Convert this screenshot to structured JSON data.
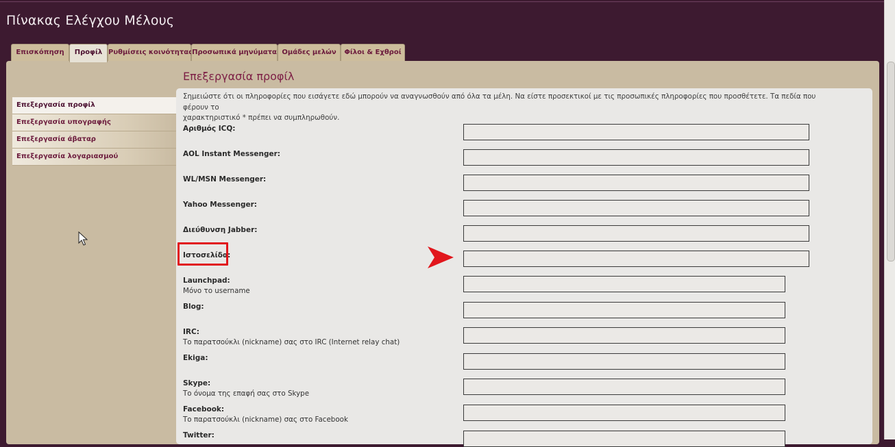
{
  "header": {
    "title": "Πίνακας Ελέγχου Μέλους"
  },
  "tabs": [
    {
      "label": "Επισκόπηση"
    },
    {
      "label": "Προφίλ"
    },
    {
      "label": "Ρυθμίσεις κοινότητας"
    },
    {
      "label": "Προσωπικά μηνύματα"
    },
    {
      "label": "Ομάδες μελών"
    },
    {
      "label": "Φίλοι & Εχθροί"
    }
  ],
  "sidebar": {
    "items": [
      {
        "label": "Επεξεργασία προφίλ"
      },
      {
        "label": "Επεξεργασία υπογραφής"
      },
      {
        "label": "Επεξεργασία άβαταρ"
      },
      {
        "label": "Επεξεργασία λογαριασμού"
      }
    ]
  },
  "main": {
    "title": "Επεξεργασία προφίλ",
    "notice_line1": "Σημειώστε ότι οι πληροφορίες που εισάγετε εδώ μπορούν να αναγνωσθούν από όλα τα μέλη. Να είστε προσεκτικοί με τις προσωπικές πληροφορίες που προσθέτετε. Τα πεδία που φέρουν το",
    "notice_line2": "χαρακτηριστικό * πρέπει να συμπληρωθούν.",
    "fields": [
      {
        "label": "Αριθμός ICQ:",
        "value": ""
      },
      {
        "label": "AOL Instant Messenger:",
        "value": ""
      },
      {
        "label": "WL/MSN Messenger:",
        "value": ""
      },
      {
        "label": "Yahoo Messenger:",
        "value": ""
      },
      {
        "label": "Διεύθυνση Jabber:",
        "value": ""
      },
      {
        "label": "Ιστοσελίδα:",
        "value": ""
      },
      {
        "label": "Launchpad:",
        "help": "Μόνο το username",
        "value": ""
      },
      {
        "label": "Blog:",
        "value": ""
      },
      {
        "label": "IRC:",
        "help": "Το παρατσούκλι (nickname) σας στο IRC (Internet relay chat)",
        "value": ""
      },
      {
        "label": "Ekiga:",
        "value": ""
      },
      {
        "label": "Skype:",
        "help": "Το όνομα της επαφή σας στο Skype",
        "value": ""
      },
      {
        "label": "Facebook:",
        "help": "Το παρατσούκλι (nickname) σας στο Facebook",
        "value": ""
      },
      {
        "label": "Twitter:",
        "value": ""
      }
    ]
  },
  "colors": {
    "header_bg": "#3d1a30",
    "panel_bg": "#c9bba2",
    "accent": "#7d1f45",
    "highlight_box": "#e1161c",
    "arrow": "#e1161c"
  },
  "icons": {
    "arrow": "arrow-right-icon",
    "cursor": "mouse-pointer-icon"
  }
}
